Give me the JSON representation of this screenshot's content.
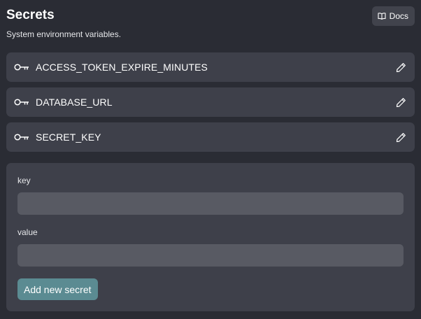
{
  "header": {
    "title": "Secrets",
    "subtitle": "System environment variables.",
    "docs_label": "Docs",
    "docs_icon": "book-open-icon"
  },
  "secrets": [
    {
      "name": "ACCESS_TOKEN_EXPIRE_MINUTES",
      "icon": "key-icon",
      "action_icon": "pencil-icon"
    },
    {
      "name": "DATABASE_URL",
      "icon": "key-icon",
      "action_icon": "pencil-icon"
    },
    {
      "name": "SECRET_KEY",
      "icon": "key-icon",
      "action_icon": "pencil-icon"
    }
  ],
  "form": {
    "key_label": "key",
    "key_value": "",
    "value_label": "value",
    "value_value": "",
    "submit_label": "Add new secret"
  },
  "colors": {
    "background": "#2a2c34",
    "card": "#3e404a",
    "input": "#585a63",
    "accent_button": "#5b8b92"
  }
}
